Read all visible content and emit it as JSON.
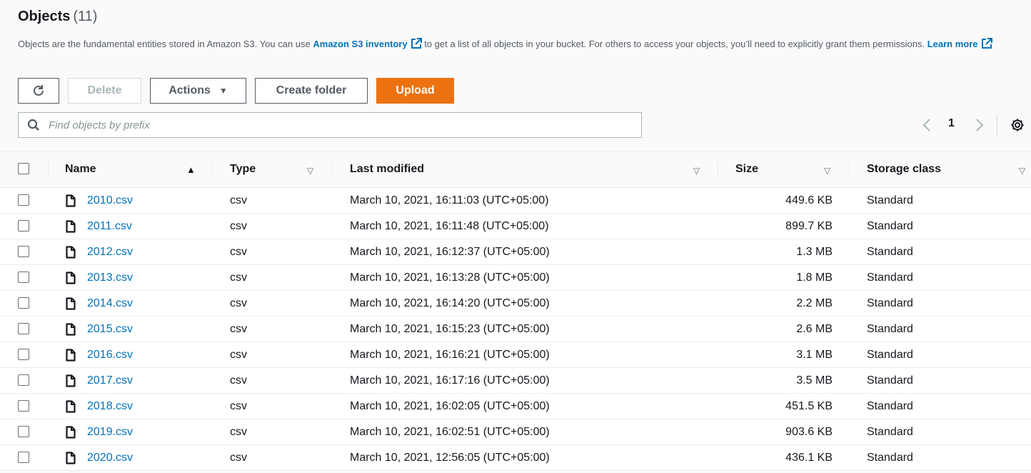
{
  "header": {
    "title": "Objects",
    "count": "(11)"
  },
  "description": {
    "part1": "Objects are the fundamental entities stored in Amazon S3. You can use ",
    "inventory_link": "Amazon S3 inventory",
    "part2": " to get a list of all objects in your bucket. For others to access your objects, you’ll need to explicitly grant them permissions. ",
    "learn_more": "Learn more"
  },
  "toolbar": {
    "refresh_icon": "refresh-icon",
    "delete_label": "Delete",
    "actions_label": "Actions",
    "create_folder_label": "Create folder",
    "upload_label": "Upload"
  },
  "search": {
    "placeholder": "Find objects by prefix",
    "value": ""
  },
  "pagination": {
    "current_page": "1"
  },
  "columns": {
    "name": "Name",
    "type": "Type",
    "last_modified": "Last modified",
    "size": "Size",
    "storage_class": "Storage class"
  },
  "rows": [
    {
      "name": "2010.csv",
      "type": "csv",
      "last_modified": "March 10, 2021, 16:11:03 (UTC+05:00)",
      "size": "449.6 KB",
      "storage_class": "Standard"
    },
    {
      "name": "2011.csv",
      "type": "csv",
      "last_modified": "March 10, 2021, 16:11:48 (UTC+05:00)",
      "size": "899.7 KB",
      "storage_class": "Standard"
    },
    {
      "name": "2012.csv",
      "type": "csv",
      "last_modified": "March 10, 2021, 16:12:37 (UTC+05:00)",
      "size": "1.3 MB",
      "storage_class": "Standard"
    },
    {
      "name": "2013.csv",
      "type": "csv",
      "last_modified": "March 10, 2021, 16:13:28 (UTC+05:00)",
      "size": "1.8 MB",
      "storage_class": "Standard"
    },
    {
      "name": "2014.csv",
      "type": "csv",
      "last_modified": "March 10, 2021, 16:14:20 (UTC+05:00)",
      "size": "2.2 MB",
      "storage_class": "Standard"
    },
    {
      "name": "2015.csv",
      "type": "csv",
      "last_modified": "March 10, 2021, 16:15:23 (UTC+05:00)",
      "size": "2.6 MB",
      "storage_class": "Standard"
    },
    {
      "name": "2016.csv",
      "type": "csv",
      "last_modified": "March 10, 2021, 16:16:21 (UTC+05:00)",
      "size": "3.1 MB",
      "storage_class": "Standard"
    },
    {
      "name": "2017.csv",
      "type": "csv",
      "last_modified": "March 10, 2021, 16:17:16 (UTC+05:00)",
      "size": "3.5 MB",
      "storage_class": "Standard"
    },
    {
      "name": "2018.csv",
      "type": "csv",
      "last_modified": "March 10, 2021, 16:02:05 (UTC+05:00)",
      "size": "451.5 KB",
      "storage_class": "Standard"
    },
    {
      "name": "2019.csv",
      "type": "csv",
      "last_modified": "March 10, 2021, 16:02:51 (UTC+05:00)",
      "size": "903.6 KB",
      "storage_class": "Standard"
    },
    {
      "name": "2020.csv",
      "type": "csv",
      "last_modified": "March 10, 2021, 12:56:05 (UTC+05:00)",
      "size": "436.1 KB",
      "storage_class": "Standard"
    }
  ],
  "colors": {
    "link": "#0073bb",
    "primary_button": "#ec7211",
    "text": "#16191f"
  }
}
